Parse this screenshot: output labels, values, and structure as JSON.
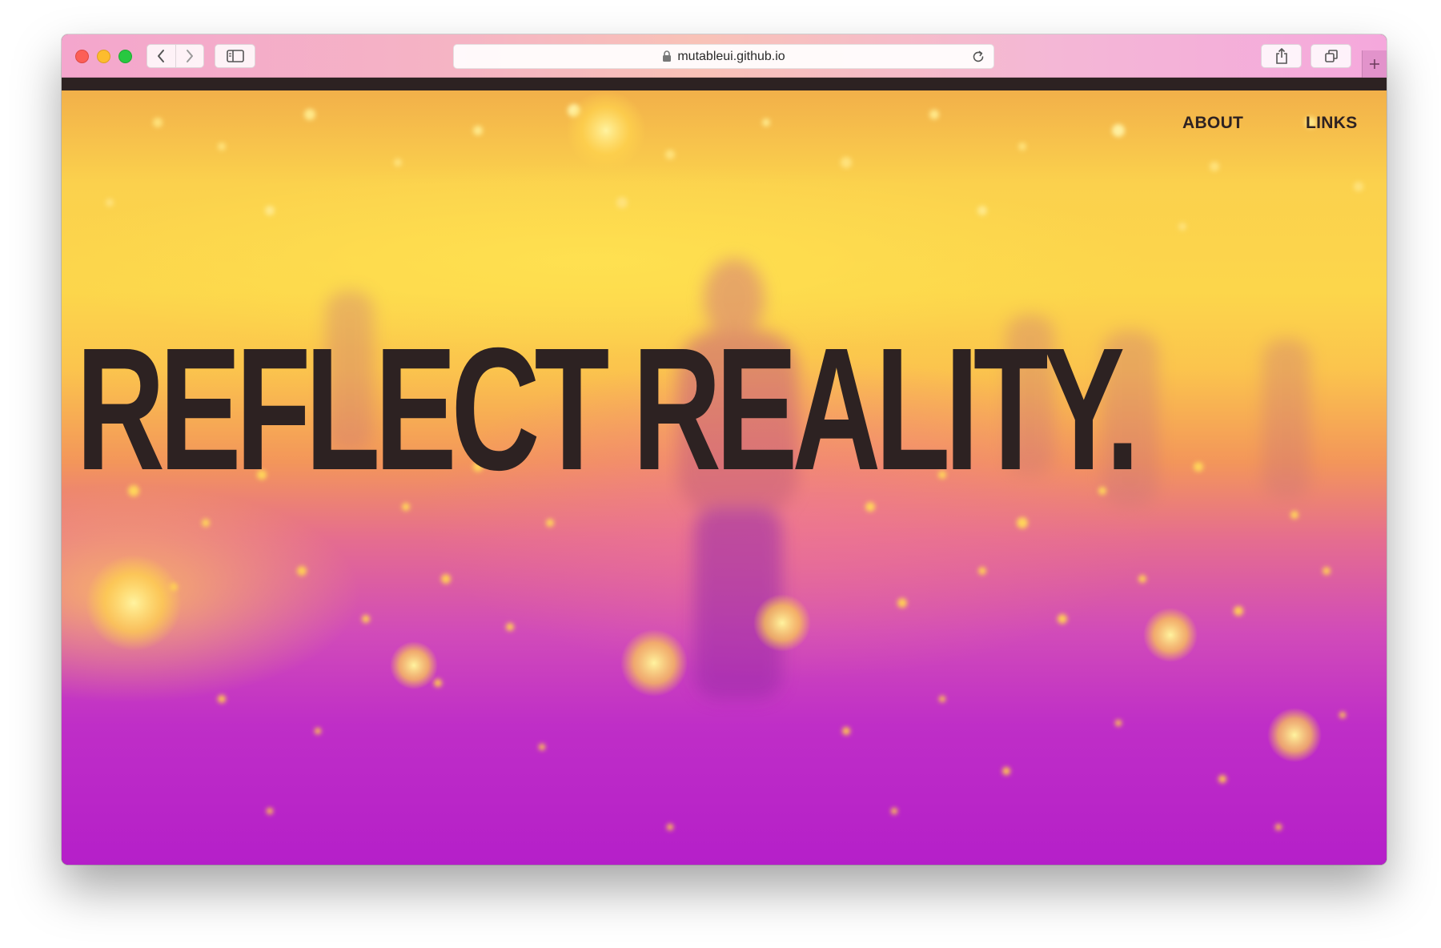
{
  "browser": {
    "url": "mutableui.github.io"
  },
  "nav": {
    "about": "ABOUT",
    "links": "LINKS"
  },
  "hero": {
    "headline": "REFLECT REALITY."
  },
  "colors": {
    "text_dark": "#2d2222",
    "gradient_yellow": "#fcd64b",
    "gradient_orange": "#f3965a",
    "gradient_magenta": "#b51fc9"
  }
}
